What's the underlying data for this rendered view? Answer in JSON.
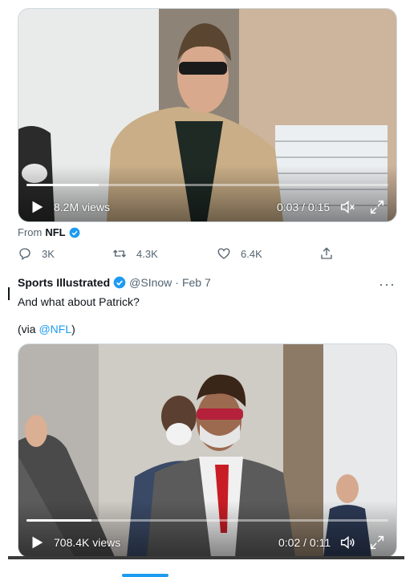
{
  "video1": {
    "views": "8.2M views",
    "time": "0:03 / 0:15",
    "progress": 0.2
  },
  "source": {
    "prefix": "From",
    "account": "NFL"
  },
  "actions": {
    "reply": "3K",
    "retweet": "4.3K",
    "like": "6.4K"
  },
  "tweet": {
    "author": "Sports Illustrated",
    "handle": "@SInow",
    "separator": "·",
    "date": "Feb 7",
    "more": "···",
    "text": "And what about Patrick?",
    "via_open": "(via ",
    "via_link": "@NFL",
    "via_close": ")"
  },
  "video2": {
    "views": "708.4K views",
    "time": "0:02 / 0:11",
    "progress": 0.18
  },
  "colors": {
    "accent": "#1d9bf0",
    "muted": "#536471",
    "text": "#0f1419"
  }
}
